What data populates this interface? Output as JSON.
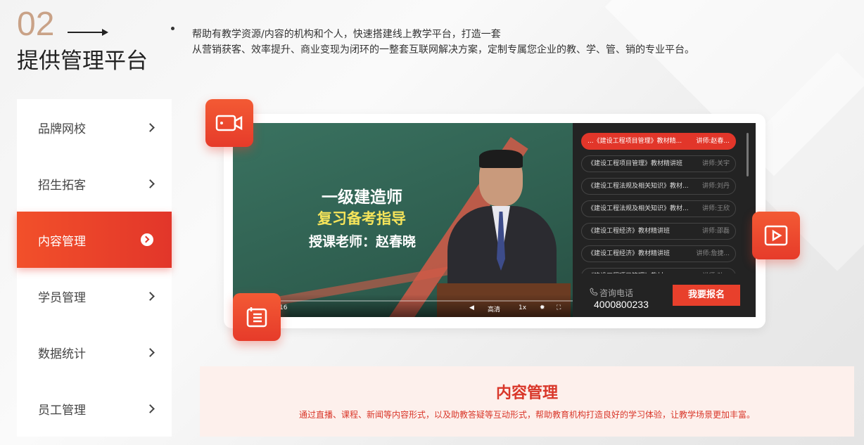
{
  "section": {
    "number": "02",
    "title": "提供管理平台",
    "description_line1": "帮助有教学资源/内容的机构和个人，快速搭建线上教学平台，打造一套",
    "description_line2": "从营销获客、效率提升、商业变现为闭环的一整套互联网解决方案，定制专属您企业的教、学、管、销的专业平台。"
  },
  "nav": {
    "items": [
      {
        "label": "品牌网校",
        "active": false
      },
      {
        "label": "招生拓客",
        "active": false
      },
      {
        "label": "内容管理",
        "active": true
      },
      {
        "label": "学员管理",
        "active": false
      },
      {
        "label": "数据统计",
        "active": false
      },
      {
        "label": "员工管理",
        "active": false
      }
    ]
  },
  "video": {
    "title": "一级建造师",
    "subtitle": "复习备考指导",
    "teacher": "授课老师：赵春晓",
    "quality": "高清",
    "speed": "1x",
    "time": "16"
  },
  "playlist": {
    "items": [
      {
        "title": "...《建设工程项目管理》教材精...",
        "teacher": "讲师:赵春..."
      },
      {
        "title": "《建设工程项目管理》教材精讲班",
        "teacher": "讲师:关宇"
      },
      {
        "title": "《建设工程法规及相关知识》教材...",
        "teacher": "讲师:刘丹"
      },
      {
        "title": "《建设工程法规及相关知识》教材...",
        "teacher": "讲师:王欣"
      },
      {
        "title": "《建设工程经济》教材精讲班",
        "teacher": "讲师:邵磊"
      },
      {
        "title": "《建设工程经济》教材精讲班",
        "teacher": "讲师:詹捷..."
      },
      {
        "title": "《建设工程项目管理》教材...",
        "teacher": "讲师:孙..."
      }
    ],
    "phone_label": "咨询电话",
    "phone_number": "4000800233",
    "enroll_label": "我要报名"
  },
  "info": {
    "title": "内容管理",
    "description": "通过直播、课程、新闻等内容形式，以及助教答疑等互动形式，帮助教育机构打造良好的学习体验，让教学场景更加丰富。"
  },
  "colors": {
    "accent": "#e2362a",
    "number": "#c9a287",
    "info_bg": "#fdf0ec"
  },
  "icons": [
    "video-camera-icon",
    "play-icon",
    "document-list-icon",
    "phone-icon"
  ]
}
